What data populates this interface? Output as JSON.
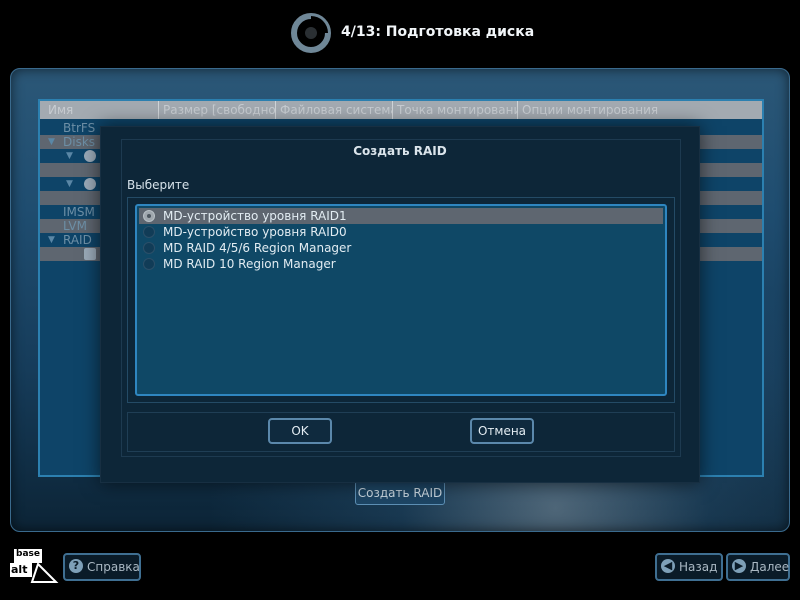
{
  "header": {
    "title": "4/13: Подготовка диска"
  },
  "tree": {
    "columns": [
      "Имя",
      "Размер [свободно]",
      "Файловая система",
      "Точка монтирования",
      "Опции монтирования"
    ],
    "rows": [
      {
        "label": "BtrFS"
      },
      {
        "label": "Disks"
      },
      {
        "label": ""
      },
      {
        "label": ""
      },
      {
        "label": ""
      },
      {
        "label": ""
      },
      {
        "label": "IMSM"
      },
      {
        "label": "LVM"
      },
      {
        "label": "RAID"
      },
      {
        "label": ""
      }
    ],
    "create_raid_button": "Создать RAID"
  },
  "dialog": {
    "title": "Создать RAID",
    "choose_label": "Выберите",
    "options": [
      {
        "label": "MD-устройство уровня RAID1",
        "selected": true
      },
      {
        "label": "MD-устройство уровня RAID0",
        "selected": false
      },
      {
        "label": "MD RAID 4/5/6 Region Manager",
        "selected": false
      },
      {
        "label": "MD RAID 10 Region Manager",
        "selected": false
      }
    ],
    "ok_label": "OK",
    "cancel_label": "Отмена"
  },
  "footer": {
    "help_label": "Справка",
    "back_label": "Назад",
    "next_label": "Далее",
    "brand_top": "base",
    "brand_bottom": "alt"
  },
  "colors": {
    "accent": "#2f86c0",
    "panel": "#1f4d70",
    "dialog_bg": "#0d2638",
    "selection": "#5e6670"
  }
}
